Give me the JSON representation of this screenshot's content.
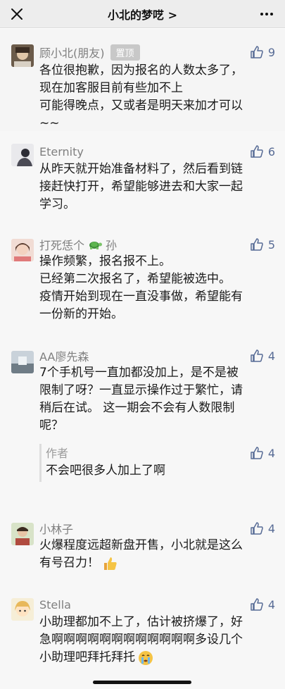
{
  "nav": {
    "title": "小北的梦呓 >"
  },
  "comments": [
    {
      "name": "顾小北(朋友)",
      "badge": "置顶",
      "likes": "9",
      "lines": [
        "各位很抱歉，因为报名的人数太多了，",
        "现在加客服目前有些加不上",
        "可能得晚点，又或者是明天来加才可以",
        "~~"
      ]
    },
    {
      "name": "Eternity",
      "likes": "6",
      "lines": [
        "从昨天就开始准备材料了，然后看到链",
        "接赶快打开，希望能够进去和大家一起",
        "学习。"
      ]
    },
    {
      "name": "打死恁个",
      "name_suffix": "孙",
      "likes": "5",
      "lines": [
        "操作频繁，报名报不上。",
        "已经第二次报名了，希望能被选中。",
        "疫情开始到现在一直没事做，希望能有",
        "一份新的开始。"
      ]
    },
    {
      "name": "AA廖先森",
      "likes": "4",
      "lines": [
        "7个手机号一直加都没加上，是不是被",
        "限制了呀？一直显示操作过于繁忙，请",
        "稍后在试。 这一期会不会有人数限制",
        "呢？"
      ],
      "reply": {
        "author": "作者",
        "likes": "4",
        "lines": [
          "不会吧很多人加上了啊"
        ]
      }
    },
    {
      "name": "小林子",
      "likes": "4",
      "lines": [
        "火爆程度远超新盘开售，小北就是这么",
        "有号召力！"
      ]
    },
    {
      "name": "Stella",
      "likes": "4",
      "lines": [
        "小助理都加不上了，估计被挤爆了，好",
        "急啊啊啊啊啊啊啊啊啊啊啊啊多设几个",
        "小助理吧拜托拜托"
      ]
    }
  ]
}
